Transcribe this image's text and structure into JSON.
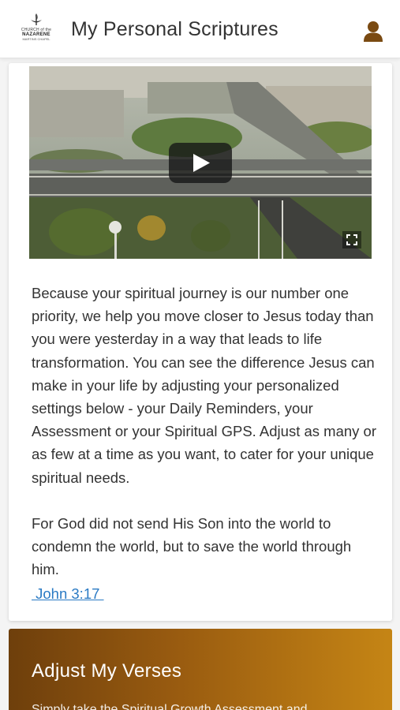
{
  "header": {
    "logo": {
      "line1": "CHURCH of the",
      "line2": "NAZARENE",
      "line3": "MARTINS CHAPEL"
    },
    "title": "My Personal Scriptures",
    "profile_icon": "user-icon"
  },
  "video": {
    "play_icon": "play-icon",
    "fullscreen_icon": "fullscreen-icon"
  },
  "content": {
    "paragraph": "Because your spiritual journey is our number one priority, we help you move closer to Jesus today than you were yesterday in a way that leads to life transformation. You can see the difference Jesus can make in your life by adjusting your personalized settings below - your Daily Reminders, your Assessment or your Spiritual GPS. Adjust as many or as few at a time as you want, to cater for your unique spiritual needs.",
    "verse": "For God did not send His Son into the world to condemn the world, but to save the world through him.",
    "verse_ref": " John 3:17 "
  },
  "adjust_section": {
    "title": "Adjust My Verses",
    "subtitle": "Simply take the Spiritual Growth Assessment and"
  },
  "colors": {
    "accent_link": "#2a7ac4",
    "section_gradient_start": "#6e3f0c",
    "section_gradient_end": "#c58515",
    "profile_icon": "#7a4a12"
  }
}
